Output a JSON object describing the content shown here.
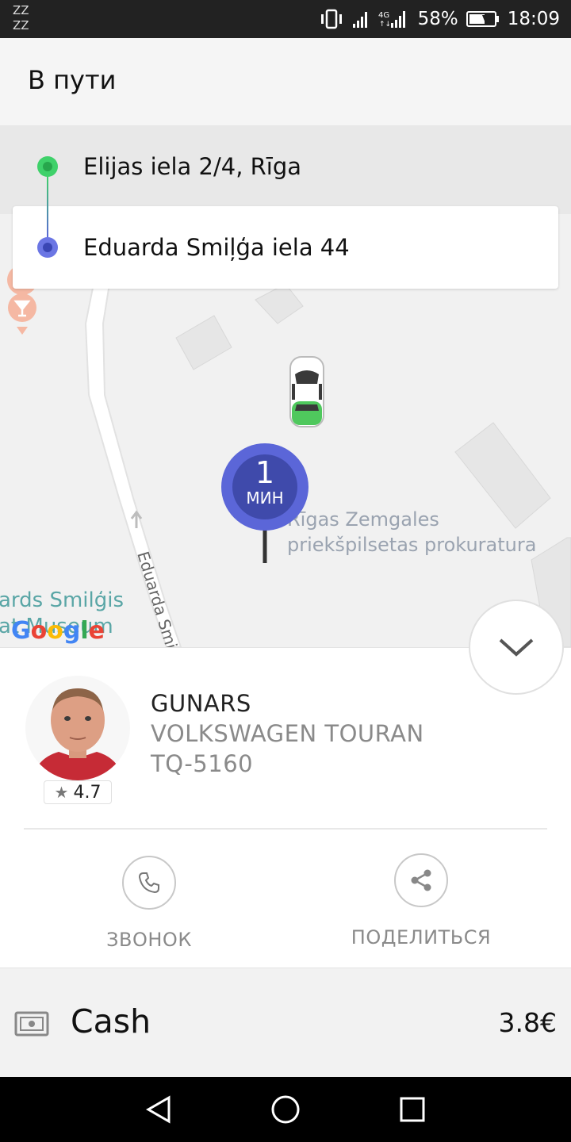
{
  "status_bar": {
    "sleep_indicator": "ZZ\nZZ",
    "network_type": "4G",
    "battery_percent": "58%",
    "time": "18:09",
    "icons": [
      "vibrate-icon",
      "signal-icon",
      "signal-4g-icon",
      "battery-icon"
    ]
  },
  "header": {
    "title": "В пути"
  },
  "route": {
    "from": "Elijas iela 2/4, Rīga",
    "to": "Eduarda Smiļģa iela 44",
    "from_color": "#3fd16a",
    "to_color": "#6b76e4"
  },
  "map": {
    "eta_number": "1",
    "eta_unit": "МИН",
    "poi_label_line1": "Rīgas Zemgales",
    "poi_label_line2": "priekšpilsetas prokuratura",
    "street_label": "Eduarda Smi",
    "place_label_line1": "ards Smilģis",
    "place_label_line2": "at Museum",
    "google_logo": "Google",
    "pin_color": "#5b66d8",
    "icons": [
      "bar-icon",
      "car-icon",
      "collapse-chevron-icon"
    ]
  },
  "driver": {
    "name": "GUNARS",
    "car_model": "VOLKSWAGEN TOURAN",
    "plate": "TQ-5160",
    "rating": "4.7"
  },
  "actions": {
    "call_label": "ЗВОНОК",
    "share_label": "ПОДЕЛИТЬСЯ"
  },
  "payment": {
    "method": "Cash",
    "price": "3.8€"
  },
  "navigation": {
    "icons": [
      "back-icon",
      "home-icon",
      "recents-icon"
    ]
  }
}
